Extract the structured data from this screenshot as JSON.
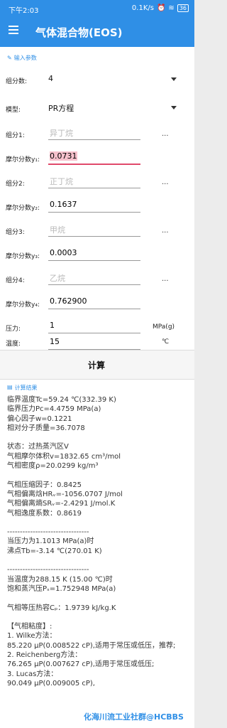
{
  "status": {
    "time": "下午2:03",
    "net": "0.1K/s",
    "battery": "36"
  },
  "appbar": {
    "title": "气体混合物(EOS)"
  },
  "form": {
    "section_label": "输入参数",
    "n_components_label": "组分数:",
    "n_components": "4",
    "model_label": "模型:",
    "model": "PR方程",
    "comp1_label": "组分1:",
    "comp1": "异丁烷",
    "y1_label": "摩尔分数y₁:",
    "y1": "0.0731",
    "comp2_label": "组分2:",
    "comp2": "正丁烷",
    "y2_label": "摩尔分数y₂:",
    "y2": "0.1637",
    "comp3_label": "组分3:",
    "comp3": "甲烷",
    "y3_label": "摩尔分数y₃:",
    "y3": "0.0003",
    "comp4_label": "组分4:",
    "comp4": "乙烷",
    "y4_label": "摩尔分数y₄:",
    "y4": "0.762900",
    "pressure_label": "压力:",
    "pressure": "1",
    "pressure_unit": "MPa(g)",
    "temp_label": "温度:",
    "temp": "15",
    "temp_unit": "℃",
    "dots": "..."
  },
  "calc": {
    "label": "计算"
  },
  "results": {
    "head": "计算结果",
    "lines": [
      "临界温度Tc=59.24 ℃(332.39 K)",
      "临界压力Pc=4.4759 MPa(a)",
      "偏心因子w=0.1221",
      "相对分子质量=36.7078",
      "",
      "状态：过热蒸汽区V",
      "气相摩尔体积v=1832.65 cm³/mol",
      "气相密度ρ=20.0299 kg/m³",
      "",
      "气相压缩因子：0.8425",
      "气相偏离焓HRᵥ=-1056.0707 J/mol",
      "气相偏离熵SRᵥ=-2.4291 J/mol.K",
      "气相逸度系数：0.8619",
      "",
      "--------------------------------",
      "当压力为1.1013 MPa(a)时",
      "沸点Tb=-3.14 ℃(270.01 K)",
      "",
      "--------------------------------",
      "当温度为288.15 K (15.00 ℃)时",
      "饱和蒸汽压Pₛ=1.752948 MPa(a)",
      "",
      "气相等压热容Cₚ：1.9739 kJ/kg.K",
      "",
      "【气相粘度】:",
      "1. Wilke方法：",
      "85.220 μP(0.008522 cP),适用于常压或低压，推荐;",
      "2. Reichenberg方法：",
      "76.265 μP(0.007627 cP),适用于常压或低压;",
      "3. Lucas方法：",
      "90.049 μP(0.009005 cP),"
    ],
    "watermark": "化海川流工业社群@HCBBS"
  }
}
